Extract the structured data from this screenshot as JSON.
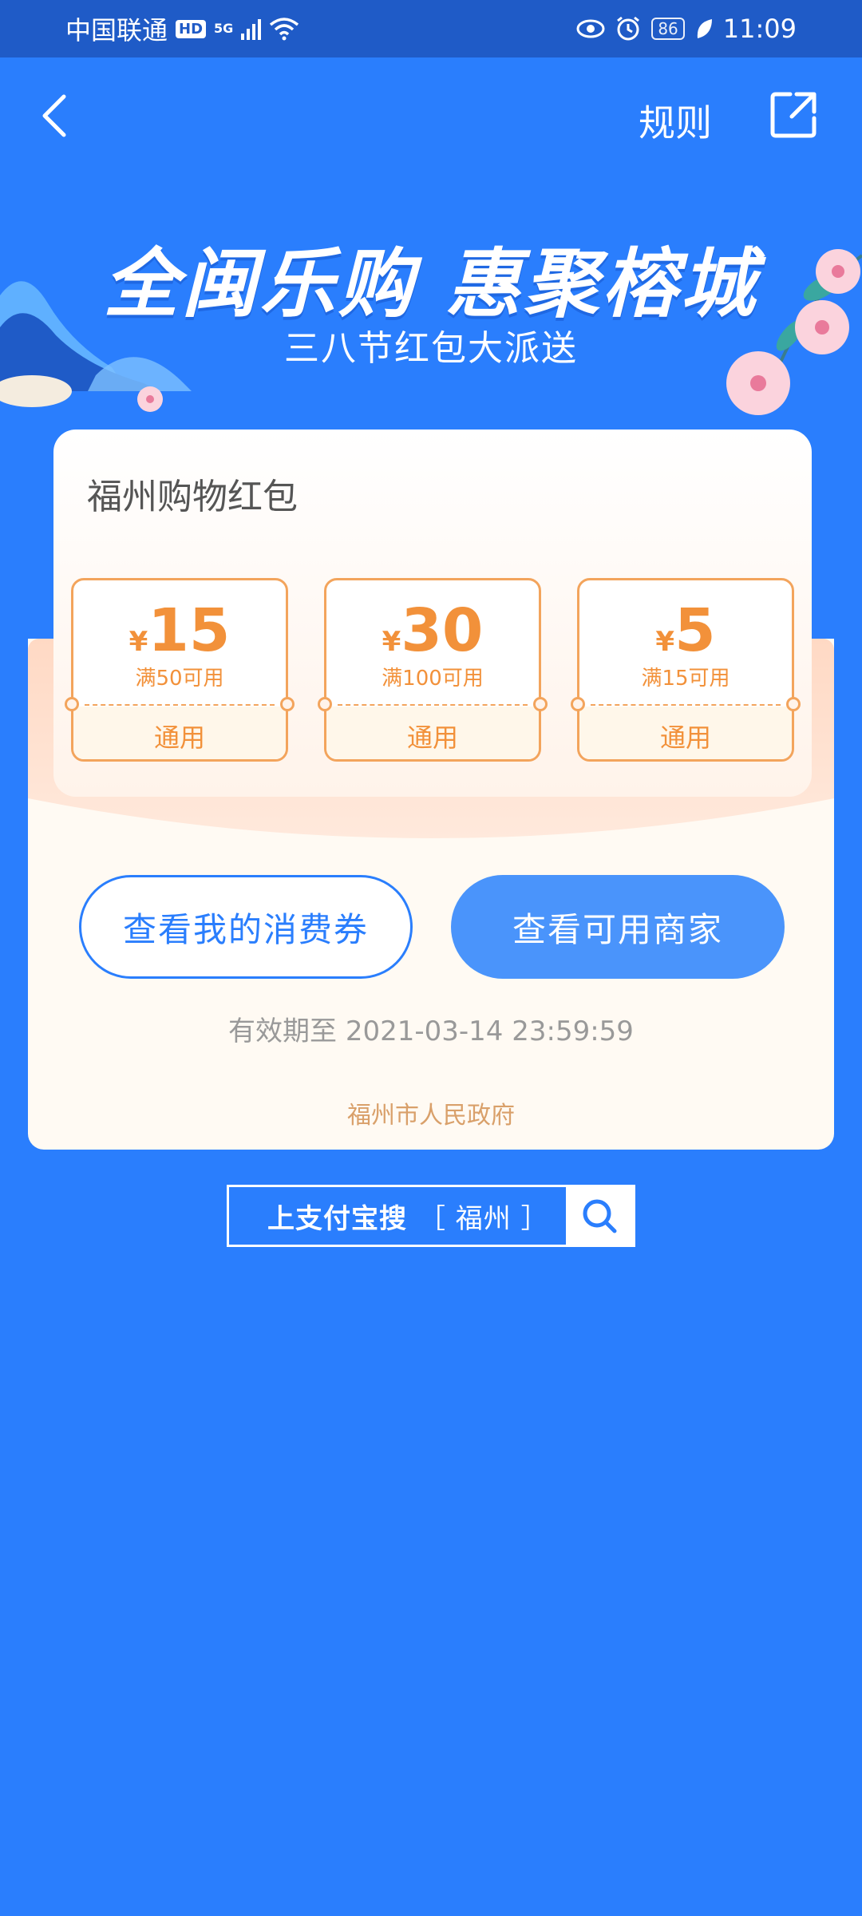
{
  "status_bar": {
    "carrier": "中国联通",
    "hd": "HD",
    "network": "5G",
    "battery": "86",
    "time": "11:09"
  },
  "nav": {
    "rules_label": "规则"
  },
  "banner": {
    "title": "全闽乐购 惠聚榕城",
    "subtitle": "三八节红包大派送"
  },
  "card": {
    "title": "福州购物红包",
    "coupons": [
      {
        "currency": "¥",
        "amount": "15",
        "condition": "满50可用",
        "scope": "通用"
      },
      {
        "currency": "¥",
        "amount": "30",
        "condition": "满100可用",
        "scope": "通用"
      },
      {
        "currency": "¥",
        "amount": "5",
        "condition": "满15可用",
        "scope": "通用"
      }
    ]
  },
  "actions": {
    "my_vouchers": "查看我的消费券",
    "merchants": "查看可用商家"
  },
  "validity": "有效期至 2021-03-14 23:59:59",
  "issuer": "福州市人民政府",
  "search": {
    "prefix": "上支付宝搜",
    "keyword": "［ 福州 ］"
  },
  "colors": {
    "background": "#2a7efd",
    "accent_orange": "#f2913a",
    "button_blue": "#4a94fb"
  }
}
